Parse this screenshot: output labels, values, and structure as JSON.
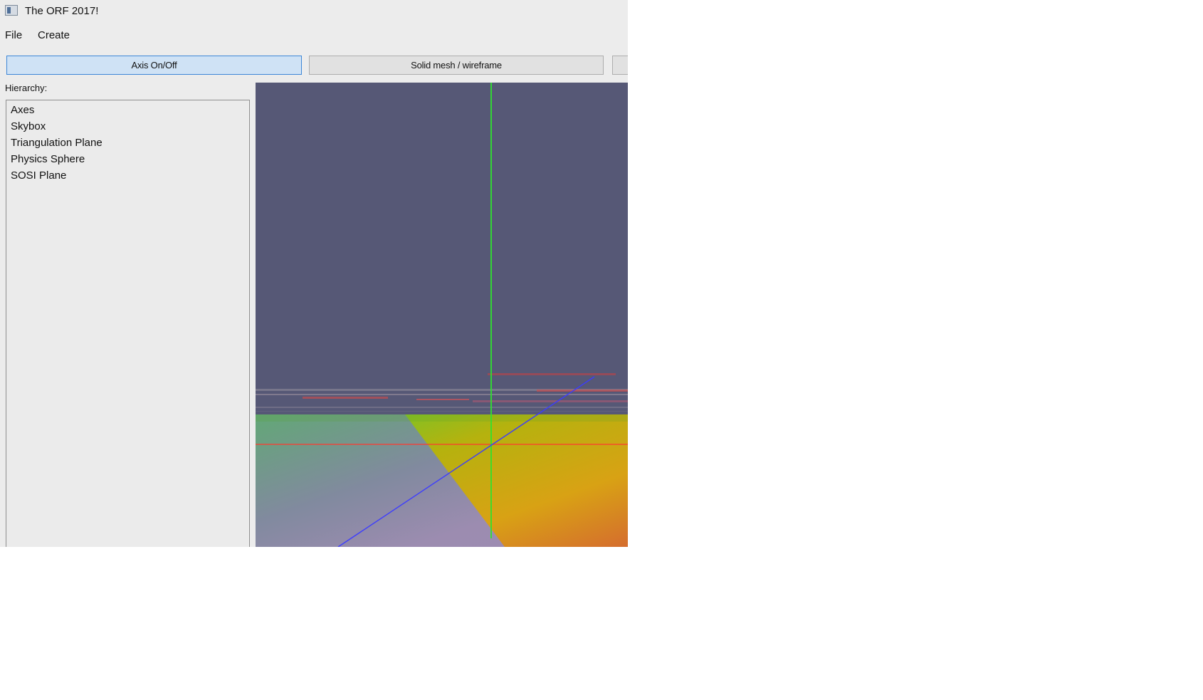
{
  "window": {
    "title": "The ORF 2017!",
    "icon": "window-app-icon"
  },
  "menu": {
    "file": "File",
    "create": "Create"
  },
  "toolbar": {
    "axis_label": "Axis On/Off",
    "mesh_label": "Solid mesh / wireframe"
  },
  "hierarchy": {
    "label": "Hierarchy:",
    "items": [
      "Axes",
      "Skybox",
      "Triangulation Plane",
      "Physics Sphere",
      "SOSI Plane"
    ]
  },
  "viewport": {
    "sky_color": "#565876",
    "axis_colors": {
      "x": "#ff3a2f",
      "y": "#2fe32f",
      "z": "#3c3cff"
    }
  }
}
